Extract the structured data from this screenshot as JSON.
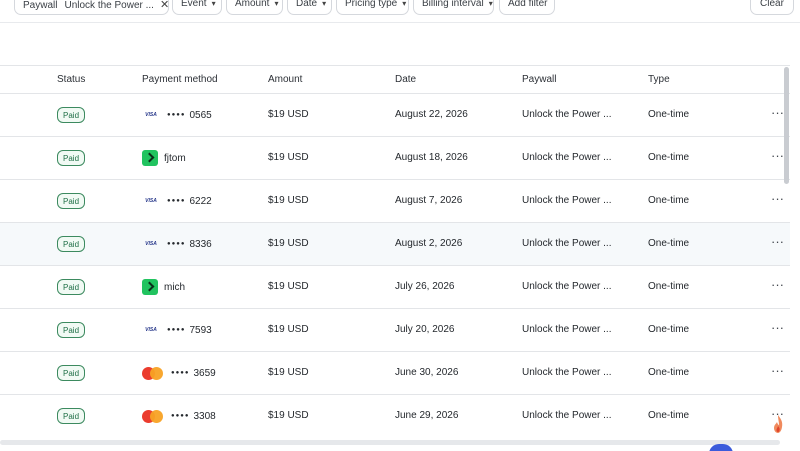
{
  "filters": {
    "paywall": {
      "label": "Paywall",
      "value": "Unlock the Power ..."
    },
    "event": "Event",
    "amount": "Amount",
    "date": "Date",
    "pricing_type": "Pricing type",
    "billing_interval": "Billing interval",
    "add_filter": "Add filter",
    "clear": "Clear"
  },
  "columns": [
    "Status",
    "Payment method",
    "Amount",
    "Date",
    "Paywall",
    "Type"
  ],
  "rows": [
    {
      "status": "Paid",
      "method": "visa",
      "account": "0565",
      "amount": "$19 USD",
      "date": "August 22, 2026",
      "paywall": "Unlock the Power ...",
      "type": "One-time"
    },
    {
      "status": "Paid",
      "method": "link",
      "account": "fjtom",
      "amount": "$19 USD",
      "date": "August 18, 2026",
      "paywall": "Unlock the Power ...",
      "type": "One-time"
    },
    {
      "status": "Paid",
      "method": "visa",
      "account": "6222",
      "amount": "$19 USD",
      "date": "August 7, 2026",
      "paywall": "Unlock the Power ...",
      "type": "One-time"
    },
    {
      "status": "Paid",
      "method": "visa",
      "account": "8336",
      "amount": "$19 USD",
      "date": "August 2, 2026",
      "paywall": "Unlock the Power ...",
      "type": "One-time"
    },
    {
      "status": "Paid",
      "method": "link",
      "account": "mich",
      "amount": "$19 USD",
      "date": "July 26, 2026",
      "paywall": "Unlock the Power ...",
      "type": "One-time"
    },
    {
      "status": "Paid",
      "method": "visa",
      "account": "7593",
      "amount": "$19 USD",
      "date": "July 20, 2026",
      "paywall": "Unlock the Power ...",
      "type": "One-time"
    },
    {
      "status": "Paid",
      "method": "mastercard",
      "account": "3659",
      "amount": "$19 USD",
      "date": "June 30, 2026",
      "paywall": "Unlock the Power ...",
      "type": "One-time"
    },
    {
      "status": "Paid",
      "method": "mastercard",
      "account": "3308",
      "amount": "$19 USD",
      "date": "June 29, 2026",
      "paywall": "Unlock the Power ...",
      "type": "One-time"
    }
  ],
  "card_dots": "●●●●",
  "visa_text": "VISA",
  "more_glyph": "···",
  "accent": {
    "paid_green": "#1f6f46",
    "link_green": "#21c35f",
    "mc_red": "#eb3c2e",
    "mc_orange": "#f8a224"
  }
}
